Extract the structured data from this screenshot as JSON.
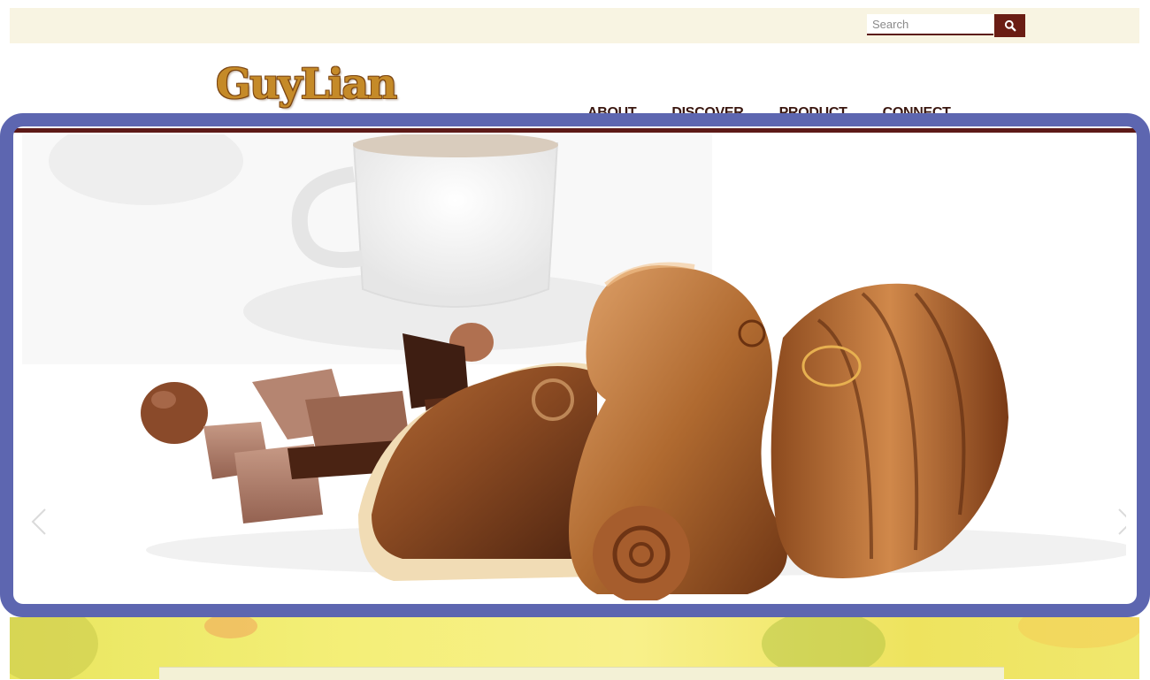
{
  "header": {
    "search": {
      "placeholder": "Search",
      "button_icon": "search-icon"
    },
    "logo_text": "GuyLian",
    "nav": [
      {
        "label": "ABOUT"
      },
      {
        "label": "DISCOVER"
      },
      {
        "label": "PRODUCT"
      },
      {
        "label": "CONNECT"
      }
    ]
  },
  "hero": {
    "image": "chocolate-seashells-coffee-hero",
    "prev_icon": "chevron-left-icon",
    "next_icon": "chevron-right-icon"
  },
  "colors": {
    "topbar_bg": "#f8f4e2",
    "brand_dark": "#5d1a17",
    "logo_gold": "#c58a28",
    "nav_text": "#3a1710",
    "highlight_frame": "#5d66b0",
    "promo_yellow": "#f4ef78"
  }
}
